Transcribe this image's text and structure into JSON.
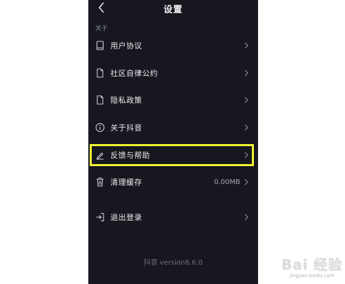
{
  "header": {
    "title": "设置"
  },
  "section": {
    "label": "关于"
  },
  "items": [
    {
      "label": "用户协议",
      "icon": "book-icon"
    },
    {
      "label": "社区自律公约",
      "icon": "document-icon"
    },
    {
      "label": "隐私政策",
      "icon": "document-icon"
    },
    {
      "label": "关于抖音",
      "icon": "info-icon"
    },
    {
      "label": "反馈与帮助",
      "icon": "edit-icon",
      "highlighted": true
    },
    {
      "label": "清理缓存",
      "icon": "trash-icon",
      "value": "0.00MB"
    },
    {
      "label": "退出登录",
      "icon": "logout-icon"
    }
  ],
  "footer": {
    "version": "抖音 version8.6.0"
  },
  "watermark": {
    "text": "Bai 经验",
    "sub": "jingyan.baidu.com"
  },
  "colors": {
    "background": "#17181f",
    "highlight": "#eef534",
    "text": "#ececef",
    "muted": "#8b8c94"
  }
}
